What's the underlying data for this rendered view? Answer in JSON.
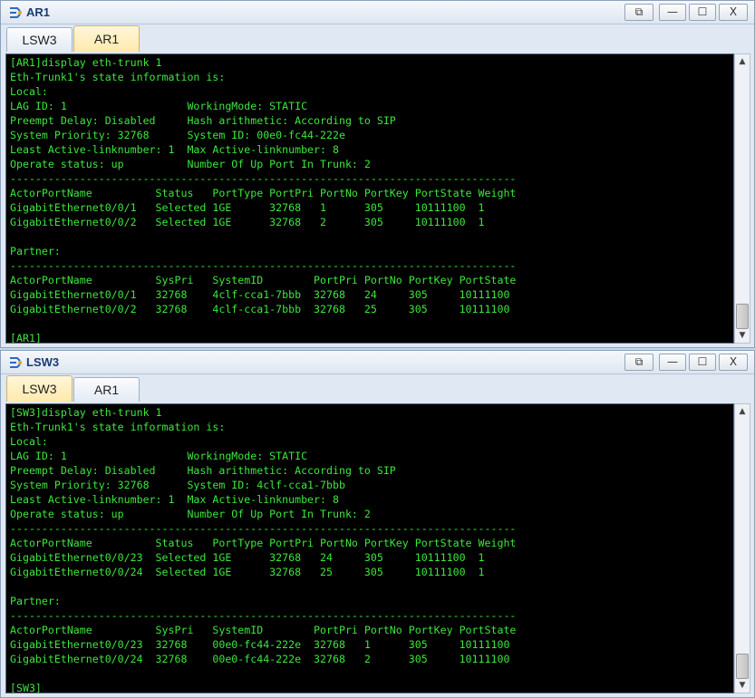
{
  "windows": [
    {
      "title": "AR1",
      "tabs": [
        {
          "label": "LSW3",
          "active": false
        },
        {
          "label": "AR1",
          "active": true
        }
      ],
      "terminal_lines": [
        "[AR1]display eth-trunk 1",
        "Eth-Trunk1's state information is:",
        "Local:",
        "LAG ID: 1                   WorkingMode: STATIC",
        "Preempt Delay: Disabled     Hash arithmetic: According to SIP",
        "System Priority: 32768      System ID: 00e0-fc44-222e",
        "Least Active-linknumber: 1  Max Active-linknumber: 8",
        "Operate status: up          Number Of Up Port In Trunk: 2",
        "--------------------------------------------------------------------------------",
        "ActorPortName          Status   PortType PortPri PortNo PortKey PortState Weight",
        "GigabitEthernet0/0/1   Selected 1GE      32768   1      305     10111100  1",
        "GigabitEthernet0/0/2   Selected 1GE      32768   2      305     10111100  1",
        "",
        "Partner:",
        "--------------------------------------------------------------------------------",
        "ActorPortName          SysPri   SystemID        PortPri PortNo PortKey PortState",
        "GigabitEthernet0/0/1   32768    4clf-cca1-7bbb  32768   24     305     10111100",
        "GigabitEthernet0/0/2   32768    4clf-cca1-7bbb  32768   25     305     10111100",
        "",
        "[AR1]"
      ]
    },
    {
      "title": "LSW3",
      "tabs": [
        {
          "label": "LSW3",
          "active": true
        },
        {
          "label": "AR1",
          "active": false
        }
      ],
      "terminal_lines": [
        "[SW3]display eth-trunk 1",
        "Eth-Trunk1's state information is:",
        "Local:",
        "LAG ID: 1                   WorkingMode: STATIC",
        "Preempt Delay: Disabled     Hash arithmetic: According to SIP",
        "System Priority: 32768      System ID: 4clf-cca1-7bbb",
        "Least Active-linknumber: 1  Max Active-linknumber: 8",
        "Operate status: up          Number Of Up Port In Trunk: 2",
        "--------------------------------------------------------------------------------",
        "ActorPortName          Status   PortType PortPri PortNo PortKey PortState Weight",
        "GigabitEthernet0/0/23  Selected 1GE      32768   24     305     10111100  1",
        "GigabitEthernet0/0/24  Selected 1GE      32768   25     305     10111100  1",
        "",
        "Partner:",
        "--------------------------------------------------------------------------------",
        "ActorPortName          SysPri   SystemID        PortPri PortNo PortKey PortState",
        "GigabitEthernet0/0/23  32768    00e0-fc44-222e  32768   1      305     10111100",
        "GigabitEthernet0/0/24  32768    00e0-fc44-222e  32768   2      305     10111100",
        "",
        "[SW3]"
      ]
    }
  ],
  "window_buttons": {
    "restore": "⧉",
    "minimize": "—",
    "maximize": "☐",
    "close": "X"
  },
  "icons": {
    "app": "ensp-app-icon",
    "scroll_up": "chevron-up-icon",
    "scroll_down": "chevron-down-icon"
  },
  "colors": {
    "terminal_bg": "#000000",
    "terminal_text": "#3ce63c",
    "title_text": "#1a3c70",
    "active_tab": "#ffe9ad"
  }
}
